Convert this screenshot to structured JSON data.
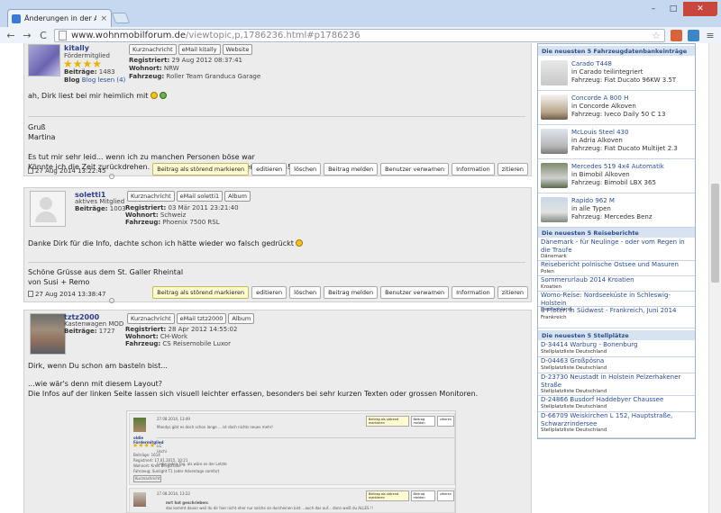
{
  "browser": {
    "tab_title": "Änderungen in der Ansich",
    "url_host": "www.wohnmobilforum.de",
    "url_path": "/viewtopic,p,1786236.html#p1786236",
    "win_min": "–",
    "win_max": "□",
    "win_close": "✕",
    "back": "←",
    "forward": "→",
    "reload": "C",
    "menu": "≡"
  },
  "posts": [
    {
      "username": "kitally",
      "rank": "Fördermitglied",
      "stars": "★★★★",
      "posts_label": "Beiträge:",
      "posts": "1483",
      "blog": "Blog lesen (4)",
      "btn_pm": "Kurznachricht",
      "btn_email": "eMail kitally",
      "btn_web": "Website",
      "reg_label": "Registriert:",
      "reg": "29 Aug 2012 08:37:41",
      "loc_label": "Wohnort:",
      "loc": "NRW",
      "veh_label": "Fahrzeug:",
      "veh": "Roller Team Granduca Garage",
      "text1": "ah, Dirk liest bei mir heimlich mit",
      "text2": "Gruß\nMartina\n\nEs tut mir sehr leid... wenn ich zu manchen Personen böse war\nKönnte ich die Zeit zurückdrehen. wär ich noch viel schlimmer gewesen!",
      "date": "27 Aug 2014 13:22:45"
    },
    {
      "username": "soletti1",
      "rank": "aktives Mitglied",
      "posts_label": "Beiträge:",
      "posts": "1003",
      "btn_pm": "Kurznachricht",
      "btn_email": "eMail soletti1",
      "btn_album": "Album",
      "reg_label": "Registriert:",
      "reg": "03 Mär 2011 23:21:40",
      "loc_label": "Wohnort:",
      "loc": "Schweiz",
      "veh_label": "Fahrzeug:",
      "veh": "Phoenix 7500 RSL",
      "text1": "Danke Dirk für die Info, dachte schon ich hätte wieder wo falsch gedrückt",
      "text2": "Schöne Grüsse aus dem St. Galler Rheintal\nvon Susi + Remo",
      "date": "27 Aug 2014 13:38:47"
    },
    {
      "username": "tztz2000",
      "rank": "Kastenwagen MOD",
      "posts_label": "Beiträge:",
      "posts": "1727",
      "btn_pm": "Kurznachricht",
      "btn_email": "eMail tztz2000",
      "btn_album": "Album",
      "reg_label": "Registriert:",
      "reg": "28 Apr 2012 14:55:02",
      "loc_label": "Wohnort:",
      "loc": "CH-Work",
      "veh_label": "Fahrzeug:",
      "veh": "CS Reisemobile Luxor",
      "text1": "Dirk, wenn Du schon am basteln bist...",
      "text2": "...wie wär's denn mit diesem Layout?\nDie Infos auf der linken Seite lassen sich visuell leichter erfassen, besonders bei sehr kurzen Texten oder grossen Monitoren."
    }
  ],
  "actions": {
    "mark": "Beitrag als störend markieren",
    "edit": "editieren",
    "delete": "löschen",
    "report": "Beitrag melden",
    "warn": "Benutzer verwarnen",
    "info": "Information",
    "quote": "zitieren"
  },
  "mini": {
    "date1": "27.08.2014, 13:49",
    "line1": "Mandys gibt es doch schon lange ... ist doch nichts neues mehr!",
    "user": "oldie",
    "rank": "Fördermitglied",
    "meta": "Beiträge: 1614\nRegistriert: 17.01.2015, 10:21\nWohnort: Kreis Bergstraße\nFahrzeug: Sunlight T1 (oder Adventage comfort",
    "line2": "LG\nUschi",
    "line3": "Liebe jeden Tag, als wäre es der Letzte",
    "pm": "Kurznachricht",
    "date2": "27.08.2014, 13:22",
    "q1": "mrt hat geschrieben:",
    "q2": "das kommt davon weil du dir hier nicht eher nur solche an durcheinen bist. ..auch das auf... dann weiß du ALLES !!",
    "b1": "Beitrag als störend markieren",
    "b2": "Beitrag melden",
    "b3": "zitieren"
  },
  "sidebar": {
    "vehicles_title": "Die neuesten 5 Fahrzeugdatenbankeinträge",
    "vehicles": [
      {
        "name": "Carado T448",
        "cat": "in Carado teilintegriert",
        "veh": "Fahrzeug: Fiat Ducato 96KW 3.5T"
      },
      {
        "name": "Concorde A 800 H",
        "cat": "in Concorde Alkoven",
        "veh": "Fahrzeug: Iveco Daily 50 C 13"
      },
      {
        "name": "McLouis Steel 430",
        "cat": "in Adria Alkoven",
        "veh": "Fahrzeug: Fiat Ducato Multijet 2.3"
      },
      {
        "name": "Mercedes 519 4x4 Automatik",
        "cat": "in Bimobil Alkoven",
        "veh": "Fahrzeug: Bimobil LBX 365"
      },
      {
        "name": "Rapido 962 M",
        "cat": "in alle Typen",
        "veh": "Fahrzeug: Mercedes Benz"
      }
    ],
    "travel_title": "Die neuesten 5 Reiseberichte",
    "travel": [
      {
        "t": "Dänemark - für Neulinge - oder vom Regen in die Traufe",
        "s": "Dänemark"
      },
      {
        "t": "Reisebericht polnische Ostsee und Masuren",
        "s": "Polen"
      },
      {
        "t": "Sommerurlaub 2014 Kroatien",
        "s": "Kroatien"
      },
      {
        "t": "Womo-Reise: Nordseeküste in Schleswig-Holstein",
        "s": "Deutschland"
      },
      {
        "t": "8 Pfoten in Südwest - Frankreich, Juni 2014",
        "s": "Frankreich"
      }
    ],
    "stell_title": "Die neuesten 5 Stellplätze",
    "stell": [
      {
        "t": "D-34414 Warburg - Bonenburg",
        "s": "Stellplatzliste Deutschland"
      },
      {
        "t": "D-04463 Großpösna",
        "s": "Stellplatzliste Deutschland"
      },
      {
        "t": "D-23730 Neustadt in Holstein Pelzerhakener Straße",
        "s": "Stellplatzliste Deutschland"
      },
      {
        "t": "D-24866 Busdorf Haddebyer Chaussee",
        "s": "Stellplatzliste Deutschland"
      },
      {
        "t": "D-66709 Weiskirchen L 152, Hauptstraße, Schwarzrindersee",
        "s": "Stellplatzliste Deutschland"
      }
    ]
  },
  "colors": {
    "link": "#2b4f9a",
    "header": "#d8e3f1",
    "star": "#e6b400"
  }
}
